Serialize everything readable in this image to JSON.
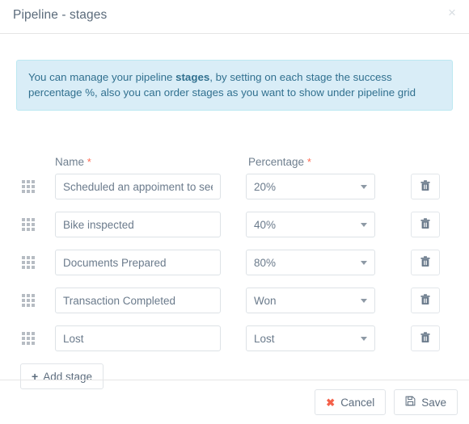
{
  "dialog": {
    "title": "Pipeline - stages",
    "close_label": "×"
  },
  "alert": {
    "text_before": "You can manage your pipeline ",
    "bold": "stages",
    "text_after": ", by setting on each stage the success percentage %, also you can order stages as you want to show under pipeline grid"
  },
  "table": {
    "headers": {
      "name": "Name",
      "percentage": "Percentage",
      "required_mark": "*"
    },
    "rows": [
      {
        "name": "Scheduled an appoiment to see the bike",
        "percentage": "20%",
        "drag_handle": "drag-handle-icon",
        "delete": "trash-icon"
      },
      {
        "name": "Bike inspected",
        "percentage": "40%",
        "drag_handle": "drag-handle-icon",
        "delete": "trash-icon"
      },
      {
        "name": "Documents Prepared",
        "percentage": "80%",
        "drag_handle": "drag-handle-icon",
        "delete": "trash-icon"
      },
      {
        "name": "Transaction Completed",
        "percentage": "Won",
        "drag_handle": "drag-handle-icon",
        "delete": "trash-icon"
      },
      {
        "name": "Lost",
        "percentage": "Lost",
        "drag_handle": "drag-handle-icon",
        "delete": "trash-icon"
      }
    ]
  },
  "add_stage": {
    "icon": "plus-icon",
    "label": "Add stage"
  },
  "footer": {
    "cancel_icon": "x-icon",
    "cancel_label": "Cancel",
    "save_icon": "floppy-disk-icon",
    "save_label": "Save"
  },
  "colors": {
    "alert_bg": "#d9edf7",
    "alert_border": "#bce8f1",
    "alert_text": "#31708f",
    "required": "#ff6b52",
    "cancel_accent": "#f4614a",
    "text": "#5d6d7e",
    "border": "#dde2e6"
  }
}
